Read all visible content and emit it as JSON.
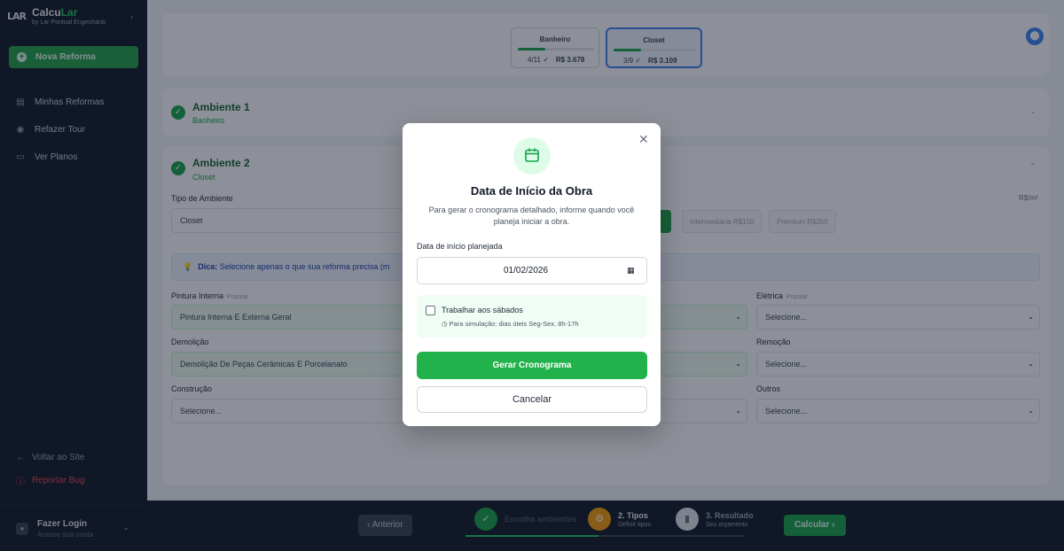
{
  "sidebar": {
    "brand_logo": "LAR",
    "brand_name_main": "Calcu",
    "brand_name_accent": "Lar",
    "brand_sub": "by Lar Pontual Engenharia",
    "new_button": "Nova Reforma",
    "items": [
      {
        "label": "Minhas Reformas",
        "icon": "clipboard-icon"
      },
      {
        "label": "Refazer Tour",
        "icon": "tour-icon"
      },
      {
        "label": "Ver Planos",
        "icon": "card-icon"
      }
    ],
    "back_site": "Voltar ao Site",
    "report_bug": "Reportar Bug",
    "login_title": "Fazer Login",
    "login_sub": "Acesse sua conta"
  },
  "top_envs": [
    {
      "label": "Banheiro",
      "count": "4/11 ✓",
      "price": "R$ 3.678",
      "progress": 0.36
    },
    {
      "label": "Closet",
      "count": "3/9 ✓",
      "price": "R$ 3.109",
      "progress": 0.33
    }
  ],
  "ambiente1": {
    "title": "Ambiente 1",
    "sub": "Banheiro"
  },
  "ambiente2": {
    "title": "Ambiente 2",
    "sub": "Closet",
    "tipo_label": "Tipo de Ambiente",
    "tipo_value": "Closet",
    "unit": "R$/m²",
    "tiers": [
      "Intermediária R$150",
      "Premium R$250"
    ],
    "tip_prefix": "Dica:",
    "tip_text": "Selecione apenas o que sua reforma precisa (m",
    "fields": {
      "pintura_label": "Pintura Interna",
      "pintura_value": "Pintura Interna E Externa Geral",
      "popular": "Popular",
      "demolicao_label": "Demolição",
      "demolicao_value": "Demolição De Peças Cerâmicas E Porcelanato",
      "construcao_label": "Construção",
      "construcao_value": "Selecione...",
      "eletrica_label": "Elétrica",
      "eletrica_value": "Selecione...",
      "remocao_label": "Remoção",
      "remocao_value": "Selecione...",
      "outros_label": "Outros",
      "outros_value": "Selecione..."
    }
  },
  "bottom": {
    "prev": "Anterior",
    "step1_title": "Escolha ambientes",
    "step2_title": "2. Tipos",
    "step2_sub": "Definir tipos",
    "step3_title": "3. Resultado",
    "step3_sub": "Seu orçamento",
    "calc": "Calcular"
  },
  "modal": {
    "title": "Data de Início da Obra",
    "desc": "Para gerar o cronograma detalhado, informe quando você planeja iniciar a obra.",
    "date_label": "Data de início planejada",
    "date_value": "01/02/2026",
    "saturday_label": "Trabalhar aos sábados",
    "saturday_note": "Para simulação: dias úteis Seg-Sex, 8h-17h",
    "generate": "Gerar Cronograma",
    "cancel": "Cancelar"
  },
  "colors": {
    "accent": "#22a34a",
    "brand_dark": "#111827",
    "info": "#3b82f6"
  }
}
